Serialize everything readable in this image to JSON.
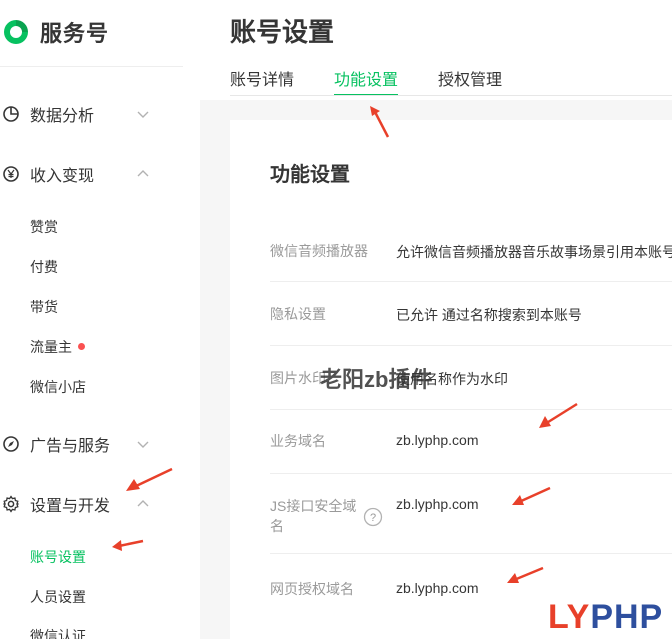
{
  "sidebar": {
    "brand": "服务号",
    "groups": [
      {
        "label": "数据分析",
        "icon": "pie-chart-icon"
      },
      {
        "label": "收入变现",
        "icon": "yen-coin-icon"
      },
      {
        "label": "广告与服务",
        "icon": "compass-icon"
      },
      {
        "label": "设置与开发",
        "icon": "gear-icon"
      }
    ],
    "income_items": [
      "赞赏",
      "付费",
      "带货",
      "流量主",
      "微信小店"
    ],
    "settings_items": [
      "账号设置",
      "人员设置",
      "微信认证"
    ]
  },
  "page_title": "账号设置",
  "tabs": [
    {
      "label": "账号详情",
      "active": false
    },
    {
      "label": "功能设置",
      "active": true
    },
    {
      "label": "授权管理",
      "active": false
    }
  ],
  "panel": {
    "title": "功能设置",
    "rows": [
      {
        "label": "微信音频播放器",
        "value": "允许微信音频播放器音乐故事场景引用本账号"
      },
      {
        "label": "隐私设置",
        "value": "已允许 通过名称搜索到本账号"
      },
      {
        "label": "图片水印",
        "value": "使用名称作为水印"
      },
      {
        "label": "业务域名",
        "value": "zb.lyphp.com"
      },
      {
        "label": "JS接口安全域名",
        "value": "zb.lyphp.com"
      },
      {
        "label": "网页授权域名",
        "value": "zb.lyphp.com"
      }
    ]
  },
  "overlay": {
    "watermark": "老阳zb插件",
    "logo_part1": "LY",
    "logo_part2": "PHP"
  },
  "colors": {
    "accent": "#07c160",
    "text": "#353535",
    "muted": "#9a9a9a",
    "annotation_arrow": "#e8402a",
    "badge_dot": "#fa5151"
  }
}
